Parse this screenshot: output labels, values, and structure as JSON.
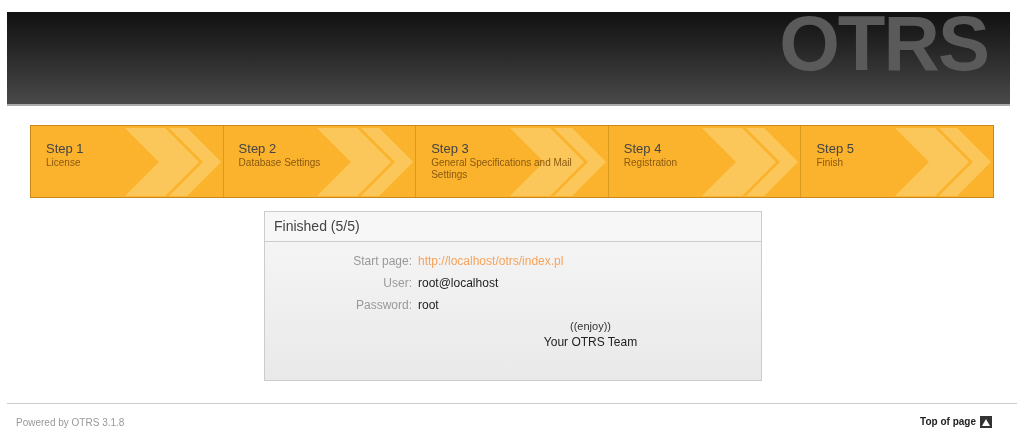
{
  "header": {
    "logo": "OTRS"
  },
  "steps": [
    {
      "title": "Step 1",
      "label": "License"
    },
    {
      "title": "Step 2",
      "label": "Database Settings"
    },
    {
      "title": "Step 3",
      "label": "General Specifications and Mail Settings"
    },
    {
      "title": "Step 4",
      "label": "Registration"
    },
    {
      "title": "Step 5",
      "label": "Finish"
    }
  ],
  "panel": {
    "title": "Finished (5/5)",
    "fields": [
      {
        "label": "Start page:",
        "value": "http://localhost/otrs/index.pl",
        "kind": "link"
      },
      {
        "label": "User:",
        "value": "root@localhost",
        "kind": "text"
      },
      {
        "label": "Password:",
        "value": "root",
        "kind": "text"
      }
    ],
    "closing": [
      "((enjoy))",
      "Your OTRS Team"
    ]
  },
  "footer": {
    "powered_by": "Powered by OTRS 3.1.8",
    "top_link": "Top of page"
  }
}
